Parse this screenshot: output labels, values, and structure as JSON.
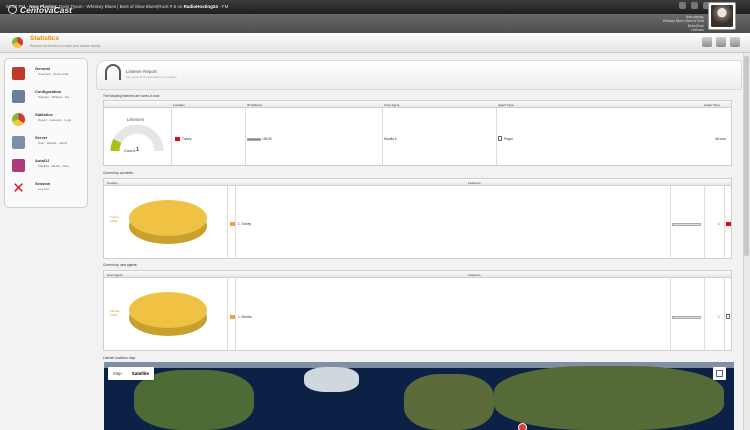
{
  "topbar": {
    "time": "02:42 PM",
    "sep": " - ",
    "now_playing_label": "Now Playing:",
    "track": "Doris Tyson - Whiskey Blues | Best of Slow Blues|Rock # 5 on",
    "station": "RadioHosting24",
    "suffix": " - FM"
  },
  "header": {
    "logo_text": "CentovaCast",
    "np_line1": "Now playing:",
    "np_line2": "Whiskey Blues | Best of Slow",
    "np_line3": "Blues|Rock",
    "np_line4": "Listeners"
  },
  "page": {
    "title": "Statistics",
    "subtitle": "Reports and trends to monitor your stream activity"
  },
  "sidebar": {
    "items": [
      {
        "title": "General",
        "links": "Overview · Quick Links",
        "icon": "home-icon",
        "color": "#c0392b"
      },
      {
        "title": "Configuration",
        "links": "Settings · Widgets · Etc",
        "icon": "settings-icon",
        "color": "#6a7f99"
      },
      {
        "title": "Statistics",
        "links": "Report · Listeners · Logs",
        "icon": "pie-chart-icon",
        "color": "#e67e22"
      },
      {
        "title": "Server",
        "links": "Stop · Reload · Admin",
        "icon": "server-icon",
        "color": "#7d8fa6"
      },
      {
        "title": "AutoDJ",
        "links": "Playlists · Media · Files",
        "icon": "music-icon",
        "color": "#b03a7a"
      },
      {
        "title": "Session",
        "links": "Log Out",
        "icon": "logout-icon",
        "color": "#d42020"
      }
    ]
  },
  "report": {
    "title": "Listener Report",
    "subtitle": "Live report of current listeners in realtime"
  },
  "tuned": {
    "caption": "The following listeners are tuned-in now:",
    "columns": [
      "Location",
      "IP Address",
      "User Agent",
      "Agent Type",
      "Listen Time"
    ],
    "gauge_title": "Listeners",
    "gauge_label": "Count:",
    "gauge_value": "1",
    "row": {
      "location": "Turkey",
      "ip": "196.80",
      "user_agent": "Mozilla 5",
      "agent_type": "Player",
      "listen_time": "46 secs"
    }
  },
  "countries": {
    "caption": "Current top countries:",
    "columns": [
      "Country",
      "Listeners"
    ],
    "pie_label": "Turkey",
    "pie_pct": "100%",
    "row": {
      "name": "1. Turkey",
      "count": "1",
      "bar": 1.0
    }
  },
  "agents": {
    "caption": "Current top user agents:",
    "columns": [
      "User Agent",
      "Listeners"
    ],
    "pie_label": "Mozilla",
    "pie_pct": "100%",
    "row": {
      "name": "1. Mozilla",
      "count": "1",
      "bar": 1.0
    }
  },
  "map": {
    "caption": "Listener locations map:",
    "btn_map": "Map",
    "btn_satellite": "Satellite"
  }
}
